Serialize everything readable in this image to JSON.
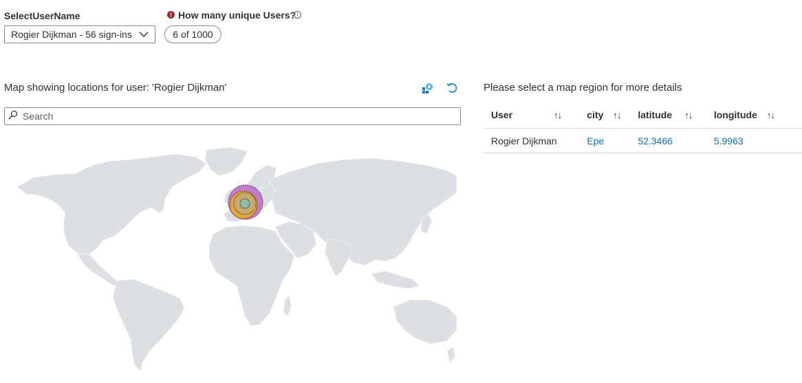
{
  "params": {
    "select_user_label": "SelectUserName",
    "select_user_value": "Rogier Dijkman - 56 sign-ins",
    "unique_users_label": "How many unique Users?",
    "unique_users_value": "6 of 1000"
  },
  "map_panel": {
    "title": "Map showing locations for user: 'Rogier Dijkman'",
    "search_placeholder": "Search",
    "icons": [
      "map-icon",
      "refresh-icon"
    ],
    "bubble_colors": [
      "#c27cc9",
      "#e8a33d",
      "#c9a86b",
      "#8fb9a8"
    ]
  },
  "details_panel": {
    "title": "Please select a map region for more details",
    "columns": [
      "User",
      "city",
      "latitude",
      "longitude"
    ],
    "sort_glyph": "↑↓",
    "rows": [
      {
        "user": "Rogier Dijkman",
        "city": "Epe",
        "latitude": "52.3466",
        "longitude": "5.9963"
      }
    ]
  }
}
